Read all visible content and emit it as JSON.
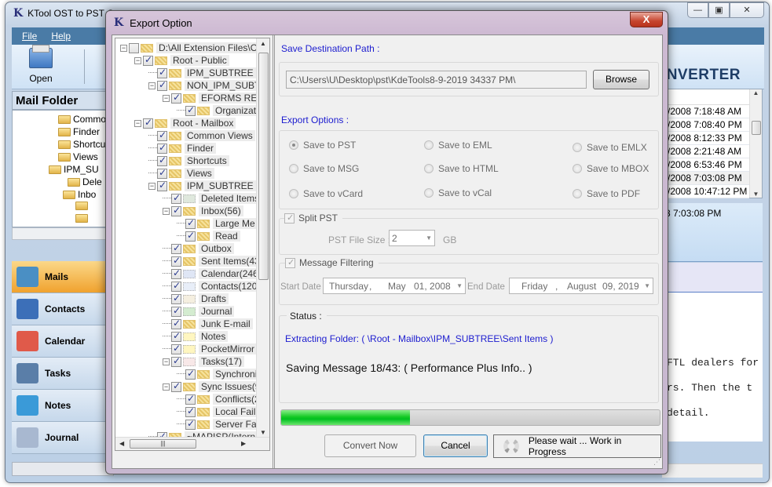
{
  "main_window": {
    "title": "KTool OST to PST C",
    "menu": [
      {
        "label": "File",
        "accel": "F"
      },
      {
        "label": "Help",
        "accel": "H"
      }
    ],
    "toolbar": {
      "open_label": "Open"
    },
    "brand_text": "NVERTER",
    "window_buttons": {
      "minimize": "▭",
      "maximize": "□",
      "close": "✕"
    },
    "mail_folder_header": "Mail Folder",
    "folder_tree": [
      "Common",
      "Finder",
      "Shortcut",
      "Views",
      "IPM_SU",
      "Dele",
      "Inbo",
      "",
      ""
    ],
    "nav": [
      {
        "label": "Mails",
        "icon": "mail-icon",
        "active": true
      },
      {
        "label": "Contacts",
        "icon": "contacts-icon",
        "active": false
      },
      {
        "label": "Calendar",
        "icon": "calendar-icon",
        "active": false
      },
      {
        "label": "Tasks",
        "icon": "tasks-icon",
        "active": false
      },
      {
        "label": "Notes",
        "icon": "notes-icon",
        "active": false
      },
      {
        "label": "Journal",
        "icon": "journal-icon",
        "active": false
      }
    ],
    "message_dates": [
      "/2008 7:18:48 AM",
      "/2008 7:08:40 PM",
      "/2008 8:12:33 PM",
      "/2008 2:21:48 AM",
      "/2008 6:53:46 PM",
      "/2008 7:03:08 PM",
      "/2008 10:47:12 PM"
    ],
    "detail_date": "8 7:03:08 PM",
    "body_lines": [
      "FTL dealers for",
      "rs.  Then the t",
      " detail."
    ]
  },
  "dialog": {
    "title": "Export Option",
    "close_label": "X",
    "tree": [
      {
        "label": "D:\\All Extension Files\\OST",
        "level": 0,
        "checked": false,
        "expander": true,
        "icon": "folder"
      },
      {
        "label": "Root - Public",
        "level": 1,
        "checked": true,
        "expander": true,
        "icon": "folder"
      },
      {
        "label": "IPM_SUBTREE",
        "level": 2,
        "checked": true,
        "expander": false,
        "icon": "folder"
      },
      {
        "label": "NON_IPM_SUBT",
        "level": 2,
        "checked": true,
        "expander": true,
        "icon": "folder"
      },
      {
        "label": "EFORMS REG",
        "level": 3,
        "checked": true,
        "expander": true,
        "icon": "folder"
      },
      {
        "label": "Organizat",
        "level": 4,
        "checked": true,
        "expander": false,
        "icon": "folder"
      },
      {
        "label": "Root - Mailbox",
        "level": 1,
        "checked": true,
        "expander": true,
        "icon": "folder"
      },
      {
        "label": "Common Views",
        "level": 2,
        "checked": true,
        "expander": false,
        "icon": "folder"
      },
      {
        "label": "Finder",
        "level": 2,
        "checked": true,
        "expander": false,
        "icon": "folder"
      },
      {
        "label": "Shortcuts",
        "level": 2,
        "checked": true,
        "expander": false,
        "icon": "folder"
      },
      {
        "label": "Views",
        "level": 2,
        "checked": true,
        "expander": false,
        "icon": "folder"
      },
      {
        "label": "IPM_SUBTREE",
        "level": 2,
        "checked": true,
        "expander": true,
        "icon": "folder"
      },
      {
        "label": "Deleted Items",
        "level": 3,
        "checked": true,
        "expander": false,
        "icon": "recycle"
      },
      {
        "label": "Inbox(56)",
        "level": 3,
        "checked": true,
        "expander": true,
        "icon": "folder"
      },
      {
        "label": "Large Me",
        "level": 4,
        "checked": true,
        "expander": false,
        "icon": "folder"
      },
      {
        "label": "Read",
        "level": 4,
        "checked": true,
        "expander": false,
        "icon": "folder"
      },
      {
        "label": "Outbox",
        "level": 3,
        "checked": true,
        "expander": false,
        "icon": "folder"
      },
      {
        "label": "Sent Items(43",
        "level": 3,
        "checked": true,
        "expander": false,
        "icon": "folder"
      },
      {
        "label": "Calendar(246",
        "level": 3,
        "checked": true,
        "expander": false,
        "icon": "calendar"
      },
      {
        "label": "Contacts(120",
        "level": 3,
        "checked": true,
        "expander": false,
        "icon": "contacts"
      },
      {
        "label": "Drafts",
        "level": 3,
        "checked": true,
        "expander": false,
        "icon": "drafts"
      },
      {
        "label": "Journal",
        "level": 3,
        "checked": true,
        "expander": false,
        "icon": "journal"
      },
      {
        "label": "Junk E-mail",
        "level": 3,
        "checked": true,
        "expander": false,
        "icon": "folder"
      },
      {
        "label": "Notes",
        "level": 3,
        "checked": true,
        "expander": false,
        "icon": "notes"
      },
      {
        "label": "PocketMirror",
        "level": 3,
        "checked": true,
        "expander": false,
        "icon": "notes"
      },
      {
        "label": "Tasks(17)",
        "level": 3,
        "checked": true,
        "expander": true,
        "icon": "tasks"
      },
      {
        "label": "Synchroni",
        "level": 4,
        "checked": true,
        "expander": false,
        "icon": "folder"
      },
      {
        "label": "Sync Issues(9",
        "level": 3,
        "checked": true,
        "expander": true,
        "icon": "folder"
      },
      {
        "label": "Conflicts(2",
        "level": 4,
        "checked": true,
        "expander": false,
        "icon": "folder"
      },
      {
        "label": "Local Fail",
        "level": 4,
        "checked": true,
        "expander": false,
        "icon": "folder"
      },
      {
        "label": "Server Fa",
        "level": 4,
        "checked": true,
        "expander": false,
        "icon": "folder"
      },
      {
        "label": "~MAPISP(Internal",
        "level": 2,
        "checked": true,
        "expander": false,
        "icon": "folder"
      }
    ],
    "save_destination_label": "Save Destination Path :",
    "destination_path": "C:\\Users\\U\\Desktop\\pst\\KdeTools8-9-2019 34337 PM\\",
    "browse_label": "Browse",
    "export_options_label": "Export Options :",
    "export_options": [
      {
        "label": "Save to PST",
        "selected": true
      },
      {
        "label": "Save to EML",
        "selected": false
      },
      {
        "label": "Save to EMLX",
        "selected": false
      },
      {
        "label": "Save to MSG",
        "selected": false
      },
      {
        "label": "Save to HTML",
        "selected": false
      },
      {
        "label": "Save to MBOX",
        "selected": false
      },
      {
        "label": "Save to vCard",
        "selected": false
      },
      {
        "label": "Save to vCal",
        "selected": false
      },
      {
        "label": "Save to PDF",
        "selected": false
      }
    ],
    "split_pst": {
      "label": "Split PST",
      "checked": true,
      "size_label": "PST File Size :",
      "size_value": "2",
      "unit": "GB"
    },
    "message_filtering": {
      "label": "Message Filtering",
      "checked": true,
      "start_label": "Start Date",
      "start_day": "Thursday",
      "start_month": "May",
      "start_date": "01, 2008",
      "end_label": "End Date",
      "end_day": "Friday",
      "end_month": "August",
      "end_date": "09, 2019"
    },
    "status": {
      "label": "Status :",
      "extracting": "Extracting Folder: ( \\Root - Mailbox\\IPM_SUBTREE\\Sent Items )",
      "saving": "Saving Message 18/43: ( Performance Plus Info.. )"
    },
    "progress_percent": 34,
    "convert_label": "Convert Now",
    "cancel_label": "Cancel",
    "wait_label": "Please wait ... Work in Progress",
    "colors": {
      "section_label": "#1c1ccf",
      "progress": "#00c020",
      "close_button": "#c6452f"
    }
  }
}
